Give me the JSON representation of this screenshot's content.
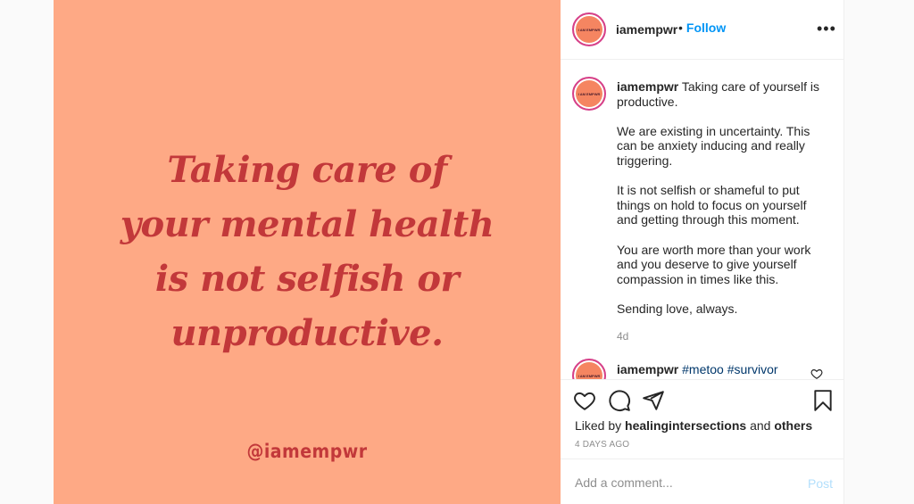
{
  "image": {
    "quote_lines": [
      "Taking care of",
      "your mental health",
      "is not selfish or",
      "unproductive."
    ],
    "handle": "@iamempwr"
  },
  "header": {
    "avatar_text": "I AM EMPWR",
    "username": "iamempwr",
    "dot": "•",
    "follow_label": "Follow",
    "more_label": "•••"
  },
  "caption": {
    "username": "iamempwr",
    "first_line": "Taking care of yourself is productive.",
    "paragraphs": [
      "We are existing in uncertainty. This can be anxiety inducing and really triggering.",
      "It is not selfish or shameful to put things on hold to focus on yourself and getting through this moment.",
      "You are worth more than your work and you deserve to give yourself compassion in times like this.",
      "Sending love, always."
    ],
    "time_ago": "4d"
  },
  "reply": {
    "username": "iamempwr",
    "hashtags": "#metoo #survivor"
  },
  "engagement": {
    "liked_by_prefix": "Liked by",
    "liked_by_user": "healingintersections",
    "and": "and",
    "others": "others",
    "posted": "4 DAYS AGO"
  },
  "comment": {
    "placeholder": "Add a comment...",
    "post_label": "Post"
  },
  "icons": [
    "heart-icon",
    "comment-icon",
    "share-icon",
    "bookmark-icon",
    "more-icon"
  ]
}
